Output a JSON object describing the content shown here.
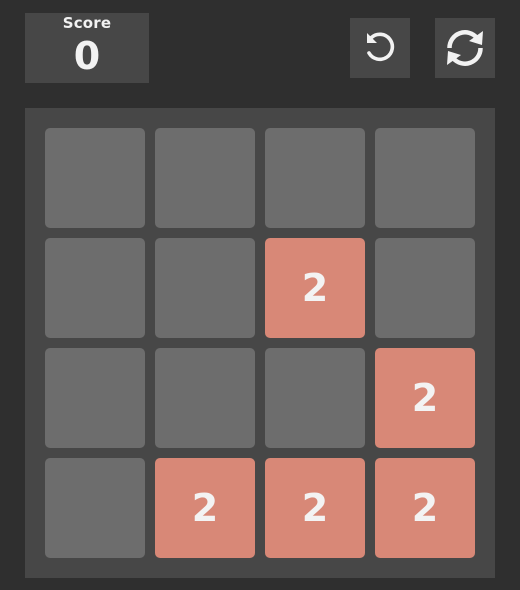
{
  "score": {
    "label": "Score",
    "value": "0"
  },
  "toolbar": {
    "undo_icon": "undo-icon",
    "restart_icon": "restart-icon"
  },
  "colors": {
    "background": "#2f2f2f",
    "panel": "#474747",
    "empty_cell": "#6d6d6d",
    "tile_2": "#d88877",
    "text": "#f3f3f3"
  },
  "board": {
    "rows": [
      [
        "",
        "",
        "",
        ""
      ],
      [
        "",
        "",
        "2",
        ""
      ],
      [
        "",
        "",
        "",
        "2"
      ],
      [
        "",
        "2",
        "2",
        "2"
      ]
    ]
  }
}
